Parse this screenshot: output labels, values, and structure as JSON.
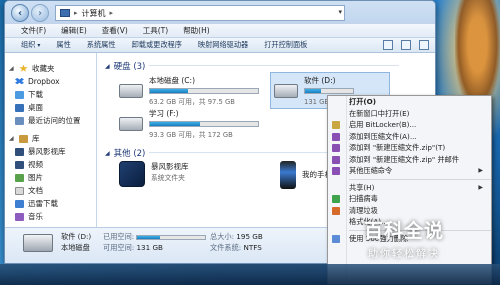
{
  "window": {
    "address": {
      "parts": [
        "计算机"
      ],
      "sep": "▸"
    },
    "menu": [
      "文件(F)",
      "编辑(E)",
      "查看(V)",
      "工具(T)",
      "帮助(H)"
    ],
    "toolbar": {
      "items": [
        "组织",
        "属性",
        "系统属性",
        "卸载或更改程序",
        "映射网络驱动器",
        "打开控制面板"
      ],
      "caret": "▾"
    },
    "nav": [
      {
        "label": "收藏夹",
        "icon": "star-icon",
        "group": true
      },
      {
        "label": "Dropbox",
        "icon": "dropbox-icon"
      },
      {
        "label": "下载",
        "icon": "download-icon"
      },
      {
        "label": "桌面",
        "icon": "desktop-icon"
      },
      {
        "label": "最近访问的位置",
        "icon": "recent-icon"
      },
      {
        "label": "库",
        "icon": "library-icon",
        "group": true
      },
      {
        "label": "暴风影视库",
        "icon": "video-library-icon"
      },
      {
        "label": "视频",
        "icon": "video-icon"
      },
      {
        "label": "图片",
        "icon": "picture-icon"
      },
      {
        "label": "文档",
        "icon": "document-icon"
      },
      {
        "label": "迅雷下载",
        "icon": "xunlei-icon"
      },
      {
        "label": "音乐",
        "icon": "music-icon"
      }
    ],
    "sections": {
      "drives": "硬盘 (3)",
      "others": "其他 (2)"
    },
    "drives": [
      {
        "name": "本地磁盘 (C:)",
        "free": "63.2 GB 可用，共 97.5 GB",
        "used_fraction": 0.35
      },
      {
        "name": "软件 (D:)",
        "free": "131 GB 可用，共 195 GB",
        "used_fraction": 0.33
      },
      {
        "name": "学习 (F:)",
        "free": "93.3 GB 可用，共 172 GB",
        "used_fraction": 0.46
      }
    ],
    "others": [
      {
        "name": "暴风影视库",
        "sub": "系统文件夹"
      },
      {
        "name": "我的手机"
      }
    ],
    "details": {
      "name": "软件 (D:)",
      "used_label": "已用空间:",
      "free_label": "可用空间:",
      "free_value": "131 GB",
      "total_label": "总大小:",
      "total_value": "195 GB",
      "fs_label": "文件系统:",
      "fs_value": "NTFS",
      "type": "本地磁盘"
    }
  },
  "context_menu": {
    "items": [
      {
        "label": "打开(O)",
        "bold": true
      },
      {
        "label": "在新窗口中打开(E)"
      },
      {
        "label": "启用 BitLocker(B)...",
        "icon": "bitlocker-icon"
      },
      {
        "label": "添加到压缩文件(A)...",
        "icon": "archive-icon"
      },
      {
        "label": "添加到 \"新建压缩文件.zip\"(T)",
        "icon": "archive-icon"
      },
      {
        "label": "添加到 \"新建压缩文件.zip\" 并邮件",
        "icon": "archive-icon"
      },
      {
        "label": "其他压缩命令",
        "icon": "archive-icon",
        "arrow": true
      },
      {
        "sep": true
      },
      {
        "label": "共享(H)",
        "arrow": true
      },
      {
        "label": "扫描病毒",
        "icon": "virus-scan-icon"
      },
      {
        "label": "清理垃圾",
        "icon": "cleanup-icon"
      },
      {
        "label": "格式化(A)..."
      },
      {
        "sep": true
      },
      {
        "label": "使用 360强力删除",
        "icon": "shred-icon"
      }
    ],
    "arrow_glyph": "▶"
  },
  "watermark": {
    "title": "百科全说",
    "subtitle": "助你轻松解决"
  }
}
